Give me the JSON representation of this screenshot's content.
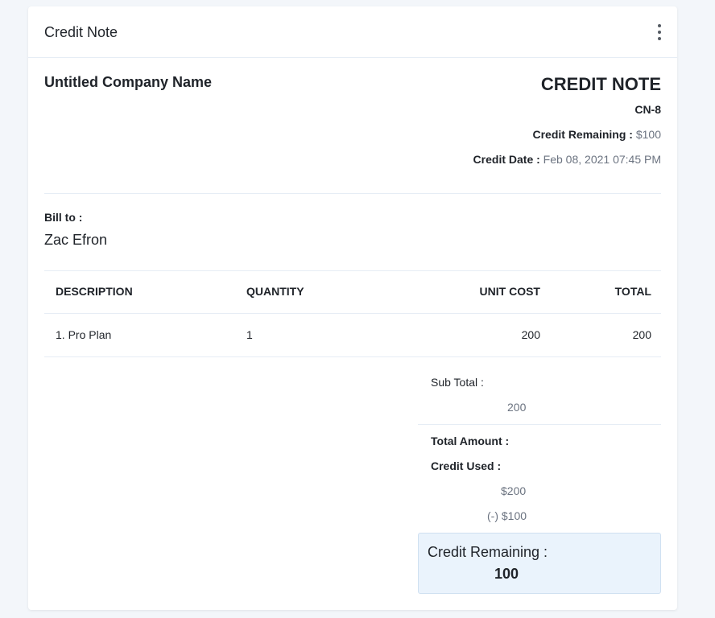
{
  "header": {
    "title": "Credit Note",
    "menu_icon": "more-vertical-icon"
  },
  "company": {
    "name": "Untitled Company Name"
  },
  "document": {
    "title": "CREDIT NOTE",
    "number": "CN-8",
    "credit_remaining_label": "Credit Remaining :",
    "credit_remaining_value": "$100",
    "credit_date_label": "Credit Date :",
    "credit_date_value": "Feb 08, 2021 07:45 PM"
  },
  "bill_to": {
    "label": "Bill to :",
    "name": "Zac Efron"
  },
  "table": {
    "columns": [
      "DESCRIPTION",
      "QUANTITY",
      "UNIT COST",
      "TOTAL"
    ],
    "rows": [
      {
        "description": "1. Pro Plan",
        "quantity": "1",
        "unit_cost": "200",
        "total": "200"
      }
    ]
  },
  "summary": {
    "subtotal_label": "Sub Total :",
    "subtotal_value": "200",
    "total_amount_label": "Total Amount :",
    "credit_used_label": "Credit Used :",
    "total_amount_value": "$200",
    "credit_used_value": "(-) $100",
    "remaining_label": "Credit Remaining :",
    "remaining_value": "100"
  },
  "colors": {
    "page_background": "#f3f6fa",
    "remaining_box_background": "#eaf3fc",
    "muted_text": "#6b7380"
  }
}
